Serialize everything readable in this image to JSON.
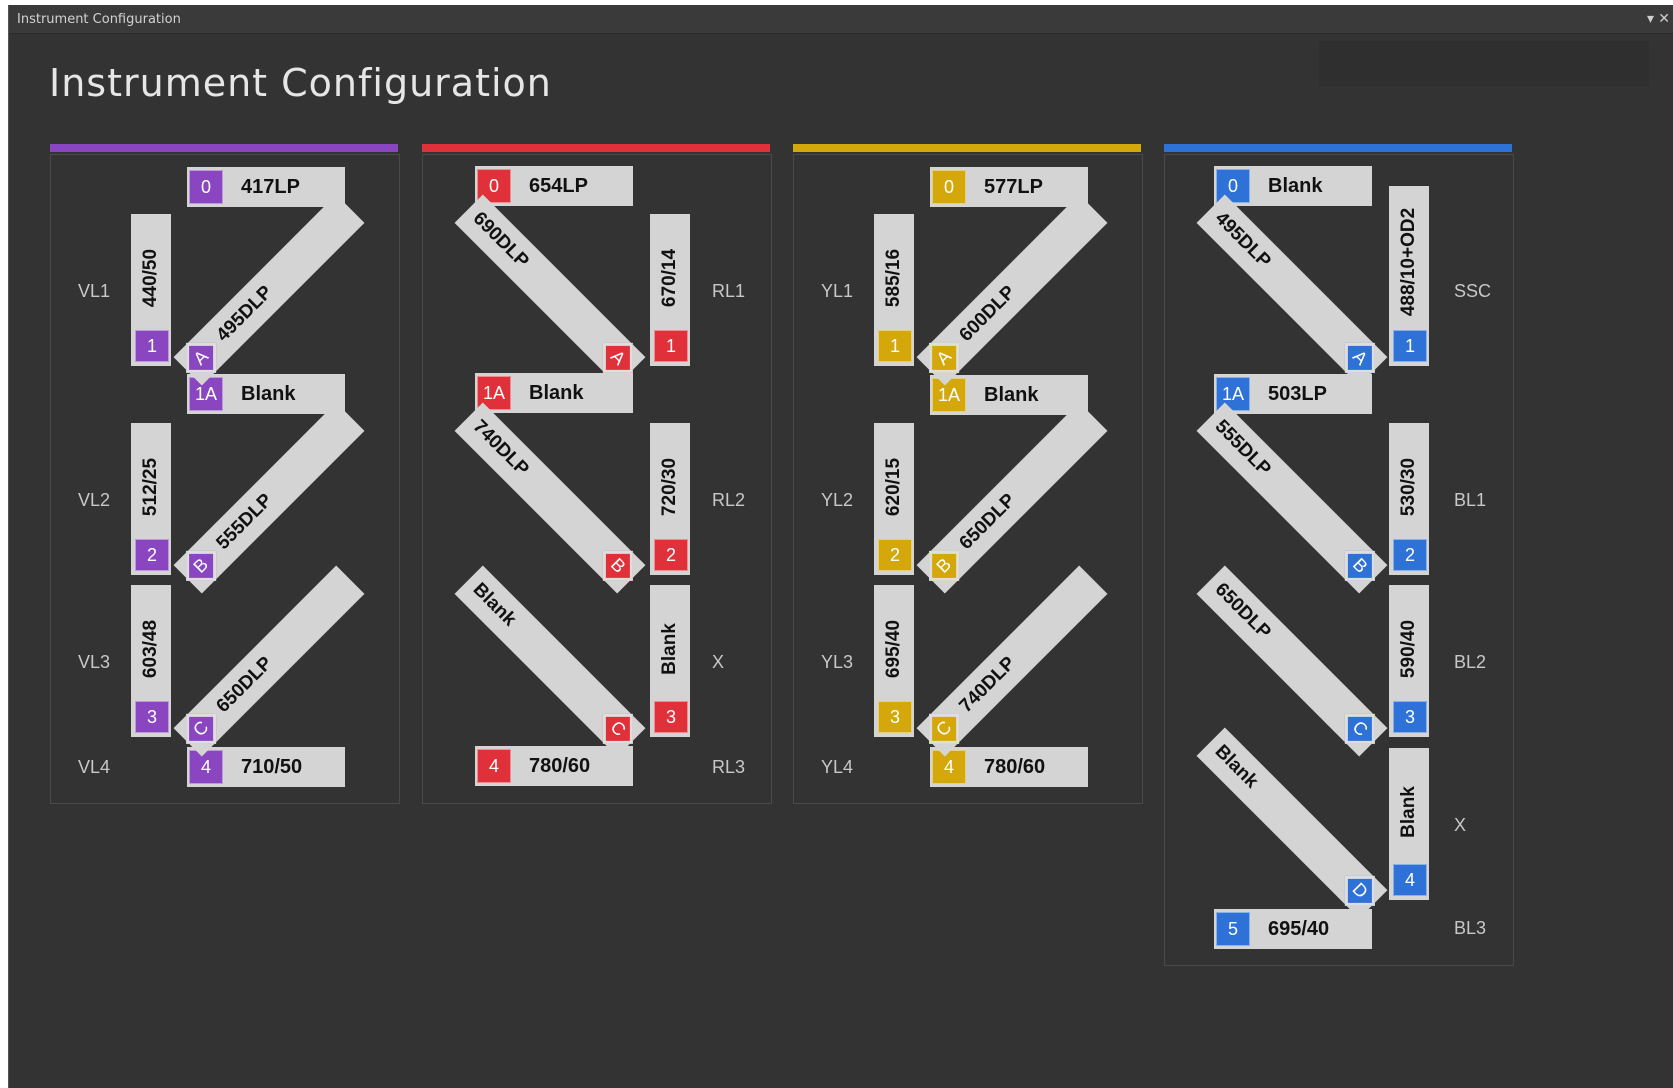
{
  "window": {
    "title": "Instrument Configuration"
  },
  "heading": "Instrument Configuration",
  "colors": {
    "violet": "#8a46c0",
    "red": "#e0303a",
    "yellow": "#d4a80a",
    "blue": "#2e72d8"
  },
  "panels": [
    {
      "name": "violet",
      "color": "#8a46c0",
      "top_filter": {
        "badge": "0",
        "label": "417LP"
      },
      "mid_filter": {
        "badge": "1A",
        "label": "Blank"
      },
      "bottom_filter": {
        "badge": "4",
        "label": "710/50"
      },
      "vertical_filters": [
        {
          "label": "440/50",
          "badge": "1"
        },
        {
          "label": "512/25",
          "badge": "2"
        },
        {
          "label": "603/48",
          "badge": "3"
        }
      ],
      "dichroics": [
        {
          "label": "495DLP",
          "badge": "A"
        },
        {
          "label": "555DLP",
          "badge": "B"
        },
        {
          "label": "650DLP",
          "badge": "C"
        }
      ],
      "detectors": [
        "VL1",
        "VL2",
        "VL3",
        "VL4"
      ]
    },
    {
      "name": "red",
      "color": "#e0303a",
      "top_filter": {
        "badge": "0",
        "label": "654LP"
      },
      "mid_filter": {
        "badge": "1A",
        "label": "Blank"
      },
      "bottom_filter": {
        "badge": "4",
        "label": "780/60"
      },
      "vertical_filters": [
        {
          "label": "670/14",
          "badge": "1"
        },
        {
          "label": "720/30",
          "badge": "2"
        },
        {
          "label": "Blank",
          "badge": "3"
        }
      ],
      "dichroics": [
        {
          "label": "690DLP",
          "badge": "A"
        },
        {
          "label": "740DLP",
          "badge": "B"
        },
        {
          "label": "Blank",
          "badge": "C"
        }
      ],
      "detectors": [
        "RL1",
        "RL2",
        "X",
        "RL3"
      ]
    },
    {
      "name": "yellow",
      "color": "#d4a80a",
      "top_filter": {
        "badge": "0",
        "label": "577LP"
      },
      "mid_filter": {
        "badge": "1A",
        "label": "Blank"
      },
      "bottom_filter": {
        "badge": "4",
        "label": "780/60"
      },
      "vertical_filters": [
        {
          "label": "585/16",
          "badge": "1"
        },
        {
          "label": "620/15",
          "badge": "2"
        },
        {
          "label": "695/40",
          "badge": "3"
        }
      ],
      "dichroics": [
        {
          "label": "600DLP",
          "badge": "A"
        },
        {
          "label": "650DLP",
          "badge": "B"
        },
        {
          "label": "740DLP",
          "badge": "C"
        }
      ],
      "detectors": [
        "YL1",
        "YL2",
        "YL3",
        "YL4"
      ]
    },
    {
      "name": "blue",
      "color": "#2e72d8",
      "top_filter": {
        "badge": "0",
        "label": "Blank"
      },
      "mid_filter": {
        "badge": "1A",
        "label": "503LP"
      },
      "bottom_filter": {
        "badge": "5",
        "label": "695/40"
      },
      "vertical_filters": [
        {
          "label": "488/10+OD2",
          "badge": "1"
        },
        {
          "label": "530/30",
          "badge": "2"
        },
        {
          "label": "590/40",
          "badge": "3"
        },
        {
          "label": "Blank",
          "badge": "4"
        }
      ],
      "dichroics": [
        {
          "label": "495DLP",
          "badge": "A"
        },
        {
          "label": "555DLP",
          "badge": "B"
        },
        {
          "label": "650DLP",
          "badge": "C"
        },
        {
          "label": "Blank",
          "badge": "D"
        }
      ],
      "detectors": [
        "SSC",
        "BL1",
        "BL2",
        "X",
        "BL3"
      ]
    }
  ]
}
